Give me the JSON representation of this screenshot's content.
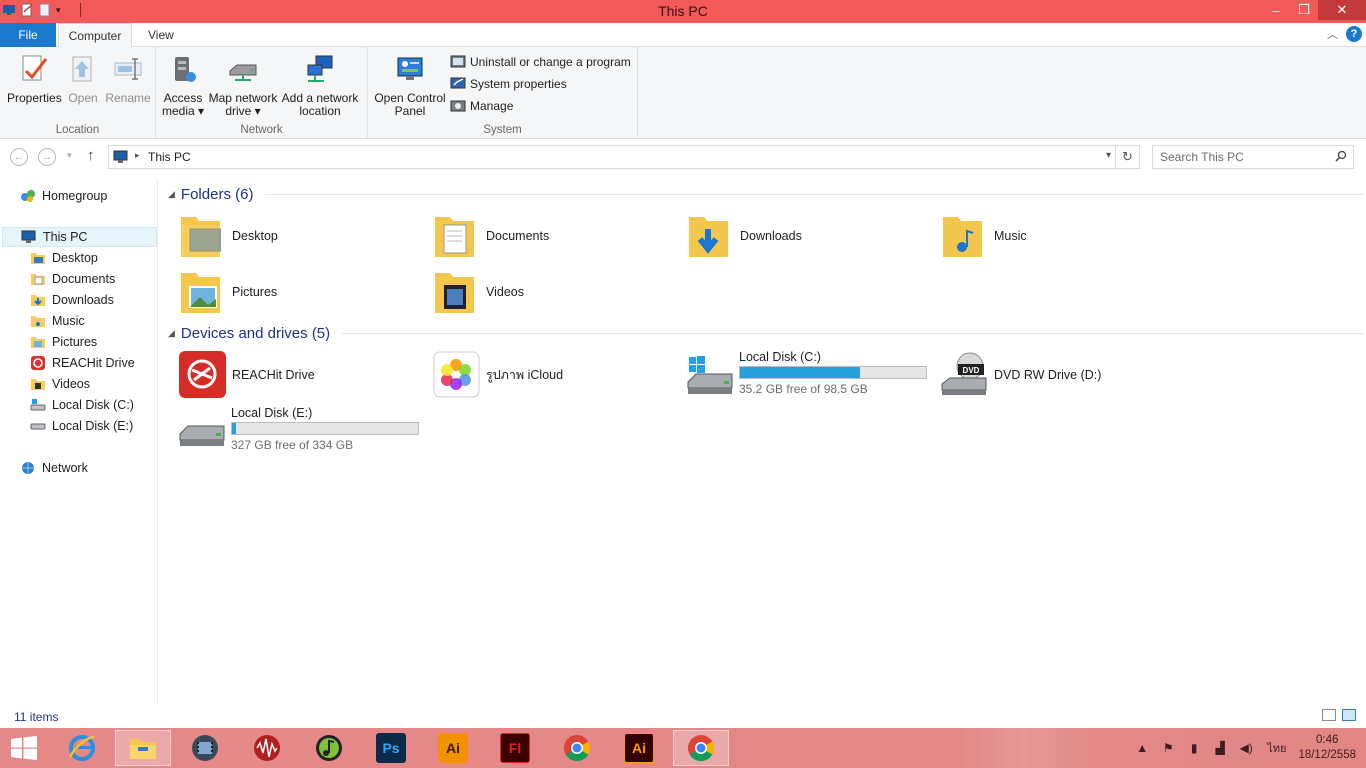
{
  "window": {
    "title": "This PC",
    "controls": {
      "minimize": "–",
      "restore": "❐",
      "close": "✕"
    }
  },
  "ribbon": {
    "tabs": {
      "file": "File",
      "computer": "Computer",
      "view": "View"
    },
    "groups": {
      "location": {
        "name": "Location",
        "properties": "Properties",
        "open": "Open",
        "rename": "Rename"
      },
      "network": {
        "name": "Network",
        "access_media_1": "Access",
        "access_media_2": "media ▾",
        "map_drive_1": "Map network",
        "map_drive_2": "drive ▾",
        "add_location_1": "Add a network",
        "add_location_2": "location"
      },
      "system": {
        "name": "System",
        "open_cp_1": "Open Control",
        "open_cp_2": "Panel",
        "uninstall": "Uninstall or change a program",
        "system_properties": "System properties",
        "manage": "Manage"
      }
    }
  },
  "address": {
    "crumb": "This PC",
    "search_placeholder": "Search This PC"
  },
  "nav": {
    "homegroup": "Homegroup",
    "this_pc": "This PC",
    "desktop": "Desktop",
    "documents": "Documents",
    "downloads": "Downloads",
    "music": "Music",
    "pictures": "Pictures",
    "reachit": "REACHit Drive",
    "videos": "Videos",
    "local_c": "Local Disk (C:)",
    "local_e": "Local Disk (E:)",
    "network": "Network"
  },
  "content": {
    "folders_header": "Folders (6)",
    "folders": {
      "desktop": "Desktop",
      "documents": "Documents",
      "downloads": "Downloads",
      "music": "Music",
      "pictures": "Pictures",
      "videos": "Videos"
    },
    "devices_header": "Devices and drives (5)",
    "devices": {
      "reachit": "REACHit Drive",
      "icloud": "รูปภาพ iCloud",
      "local_c": {
        "name": "Local Disk (C:)",
        "free": "35.2 GB free of 98.5 GB",
        "used_fraction": 0.643
      },
      "dvd": "DVD RW Drive (D:)",
      "local_e": {
        "name": "Local Disk (E:)",
        "free": "327 GB free of 334 GB",
        "used_fraction": 0.021
      }
    }
  },
  "status": {
    "count": "11 items"
  },
  "taskbar": {
    "apps": {
      "ps": "Ps",
      "ai1": "Ai",
      "fl": "Fl",
      "ai2": "Ai"
    },
    "lang": "ไทย",
    "time": "0:46",
    "date": "18/12/2558"
  },
  "colors": {
    "titlebar": "#f25a5a",
    "accent": "#1979ca",
    "drive_bar": "#26a0da",
    "group_header": "#1e3287"
  }
}
